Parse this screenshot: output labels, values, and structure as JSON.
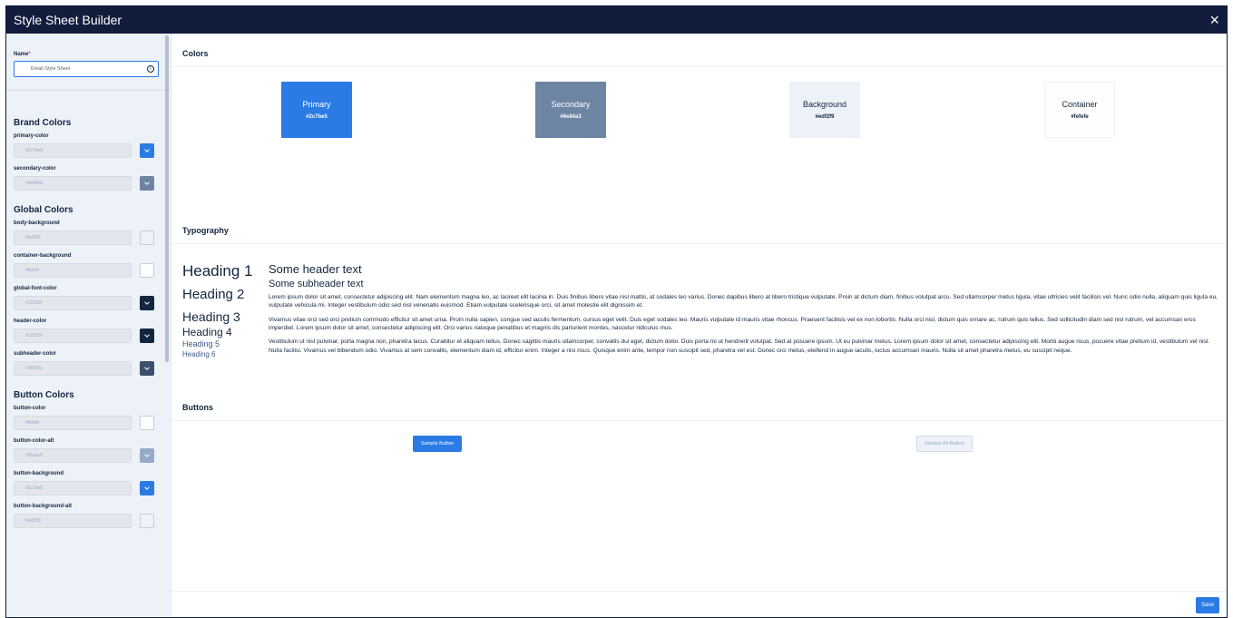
{
  "window": {
    "title": "Style Sheet Builder",
    "close_label": "×"
  },
  "sidebar": {
    "name_label": "Name",
    "required_mark": "*",
    "name_value": "Email Style Sheet",
    "info_icon": "i",
    "groups": [
      {
        "title": "Brand Colors",
        "fields": [
          {
            "label": "primary-color",
            "value": "#2c7be5",
            "swatch": "#2c7be5",
            "chevron": true
          },
          {
            "label": "secondary-color",
            "value": "#6e84a3",
            "swatch": "#6e84a3",
            "chevron": true
          }
        ]
      },
      {
        "title": "Global Colors",
        "fields": [
          {
            "label": "body-background",
            "value": "#edf2f9",
            "swatch": "#edf2f9",
            "chevron": false
          },
          {
            "label": "container-background",
            "value": "#fefefe",
            "swatch": "#fefefe",
            "chevron": false
          },
          {
            "label": "global-font-color",
            "value": "#12263f",
            "swatch": "#12263f",
            "chevron": true
          },
          {
            "label": "header-color",
            "value": "#12263f",
            "swatch": "#12263f",
            "chevron": true
          },
          {
            "label": "subheader-color",
            "value": "#3b506c",
            "swatch": "#3b506c",
            "chevron": true
          }
        ]
      },
      {
        "title": "Button Colors",
        "fields": [
          {
            "label": "button-color",
            "value": "#fefefe",
            "swatch": "#fefefe",
            "chevron": false
          },
          {
            "label": "button-color-alt",
            "value": "#95aac9",
            "swatch": "#95aac9",
            "chevron": true
          },
          {
            "label": "button-background",
            "value": "#2c7be5",
            "swatch": "#2c7be5",
            "chevron": true
          },
          {
            "label": "button-background-alt",
            "value": "#edf2f9",
            "swatch": "#edf2f9",
            "chevron": false
          }
        ]
      }
    ]
  },
  "colors": {
    "title": "Colors",
    "cards": [
      {
        "name": "Primary",
        "hex": "#2c7be5",
        "bg": "#2c7be5",
        "fg": "#ffffff",
        "border": "#2c7be5"
      },
      {
        "name": "Secondary",
        "hex": "#6e84a3",
        "bg": "#6e84a3",
        "fg": "#ffffff",
        "border": "#6e84a3"
      },
      {
        "name": "Background",
        "hex": "#edf2f9",
        "bg": "#edf2f9",
        "fg": "#12263f",
        "border": "#edf2f9"
      },
      {
        "name": "Container",
        "hex": "#fefefe",
        "bg": "#fefefe",
        "fg": "#12263f",
        "border": "#edf2f9"
      }
    ]
  },
  "typography": {
    "title": "Typography",
    "h1": "Heading 1",
    "h2": "Heading 2",
    "h3": "Heading 3",
    "h4": "Heading 4",
    "h5": "Heading 5",
    "h6": "Heading 6",
    "header_text": "Some header text",
    "subheader_text": "Some subheader text",
    "paragraphs": [
      "Lorem ipsum dolor sit amet, consectetur adipiscing elit. Nam elementum magna leo, ac laoreet elit lacinia in. Duis finibus libero vitae nisl mattis, at sodales leo varius. Donec dapibus libero at libero tristique vulputate. Proin at dictum diam, finibus volutpat arcu. Sed ullamcorper metus ligula, vitae ultricies velit facilisis vel. Nunc odio nulla, aliquam quis ligula eu, vulputate vehicula mi. Integer vestibulum odio sed nisl venenatis euismod. Etiam vulputate scelerisque orci, sit amet molestie elit dignissim et.",
      "Vivamus vitae orci sed orci pretium commodo efficitur sit amet urna. Proin nulla sapien, congue sed iaculis fermentum, cursus eget velit. Duis eget sodales leo. Mauris vulputate id mauris vitae rhoncus. Praesent facilisis vel ex non lobortis. Nulla orci nisl, dictum quis ornare ac, rutrum quis tellus. Sed sollicitudin diam sed nisl rutrum, vel accumsan eros imperdiet. Lorem ipsum dolor sit amet, consectetur adipiscing elit. Orci varius natoque penatibus et magnis dis parturient montes, nascetur ridiculus mus.",
      "Vestibulum ut nisl pulvinar, porta magna non, pharetra lacus. Curabitur et aliquam tellus. Donec sagittis mauris ullamcorper, convallis dui eget, dictum dolor. Duis porta mi ut hendrerit volutpat. Sed at posuere ipsum. Ut eu pulvinar metus. Lorem ipsum dolor sit amet, consectetur adipiscing elit. Morbi augue risus, posuere vitae pretium id, vestibulum vel nisl. Nulla facilisi. Vivamus vel bibendum odio. Vivamus at sem convallis, elementum diam id, efficitur enim. Integer a nisi risus. Quisque enim ante, tempor non suscipit sed, pharetra vel est. Donec orci metus, eleifend in augue iaculis, luctus accumsan mauris. Nulla sit amet pharetra metus, eu suscipit neque."
    ]
  },
  "buttons": {
    "title": "Buttons",
    "sample_label": "Sample Button",
    "sample_alt_label": "Sample Alt Button"
  },
  "footer": {
    "save_label": "Save"
  }
}
